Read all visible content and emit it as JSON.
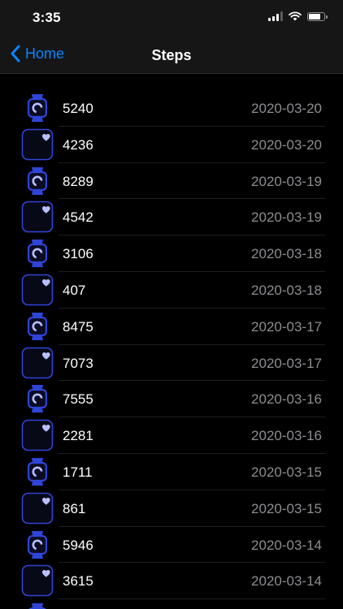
{
  "status_bar": {
    "time": "3:35",
    "icons": [
      "cellular-signal-icon",
      "wifi-icon",
      "battery-icon"
    ]
  },
  "nav": {
    "back_label": "Home",
    "title": "Steps"
  },
  "colors": {
    "accent": "#0a84ff",
    "icon_blue": "#2f44d8",
    "icon_light": "#b8bfff",
    "date_gray": "#8d8d92",
    "background": "#000000",
    "bar_background": "#161617"
  },
  "entries": [
    {
      "source_icon": "watch-icon",
      "value": "5240",
      "date": "2020-03-20"
    },
    {
      "source_icon": "phone-heart-icon",
      "value": "4236",
      "date": "2020-03-20"
    },
    {
      "source_icon": "watch-icon",
      "value": "8289",
      "date": "2020-03-19"
    },
    {
      "source_icon": "phone-heart-icon",
      "value": "4542",
      "date": "2020-03-19"
    },
    {
      "source_icon": "watch-icon",
      "value": "3106",
      "date": "2020-03-18"
    },
    {
      "source_icon": "phone-heart-icon",
      "value": "407",
      "date": "2020-03-18"
    },
    {
      "source_icon": "watch-icon",
      "value": "8475",
      "date": "2020-03-17"
    },
    {
      "source_icon": "phone-heart-icon",
      "value": "7073",
      "date": "2020-03-17"
    },
    {
      "source_icon": "watch-icon",
      "value": "7555",
      "date": "2020-03-16"
    },
    {
      "source_icon": "phone-heart-icon",
      "value": "2281",
      "date": "2020-03-16"
    },
    {
      "source_icon": "watch-icon",
      "value": "1711",
      "date": "2020-03-15"
    },
    {
      "source_icon": "phone-heart-icon",
      "value": "861",
      "date": "2020-03-15"
    },
    {
      "source_icon": "watch-icon",
      "value": "5946",
      "date": "2020-03-14"
    },
    {
      "source_icon": "phone-heart-icon",
      "value": "3615",
      "date": "2020-03-14"
    },
    {
      "source_icon": "watch-icon",
      "value": "",
      "date": ""
    }
  ]
}
